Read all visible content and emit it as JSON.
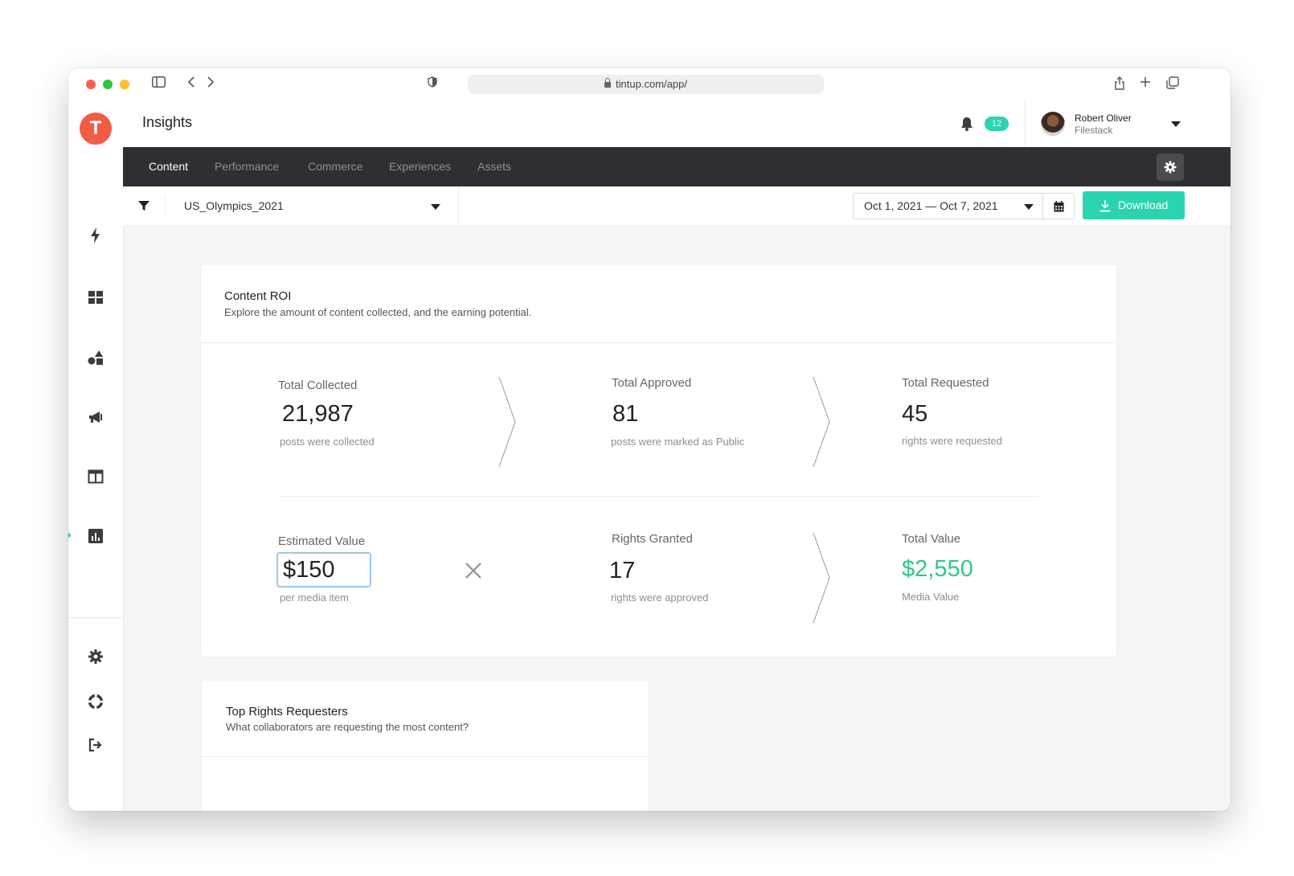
{
  "browser": {
    "url": "tintup.com/app/"
  },
  "app": {
    "logo_letter": "T",
    "page_title": "Insights",
    "notifications_count": "12",
    "user": {
      "name": "Robert Oliver",
      "org": "Filestack"
    }
  },
  "tabs": [
    {
      "label": "Content",
      "active": true
    },
    {
      "label": "Performance",
      "active": false
    },
    {
      "label": "Commerce",
      "active": false
    },
    {
      "label": "Experiences",
      "active": false
    },
    {
      "label": "Assets",
      "active": false
    }
  ],
  "filters": {
    "campaign": "US_Olympics_2021",
    "date_range": "Oct 1, 2021 — Oct 7, 2021",
    "download_label": "Download"
  },
  "roi": {
    "title": "Content ROI",
    "subtitle": "Explore the amount of content collected, and the earning potential.",
    "total_collected": {
      "label": "Total Collected",
      "value": "21,987",
      "sub": "posts were collected"
    },
    "total_approved": {
      "label": "Total Approved",
      "value": "81",
      "sub": "posts were marked as Public"
    },
    "total_requested": {
      "label": "Total Requested",
      "value": "45",
      "sub": "rights were requested"
    },
    "estimated_value": {
      "label": "Estimated Value",
      "value": "$150",
      "sub": "per media item"
    },
    "rights_granted": {
      "label": "Rights Granted",
      "value": "17",
      "sub": "rights were approved"
    },
    "total_value": {
      "label": "Total Value",
      "value": "$2,550",
      "sub": "Media Value"
    }
  },
  "rights_requesters": {
    "title": "Top Rights Requesters",
    "subtitle": "What collaborators are requesting the most content?"
  },
  "colors": {
    "accent": "#2bd4b1",
    "logo": "#f25c45",
    "tabbar": "#2e2f33",
    "value_green": "#2dc88a"
  }
}
